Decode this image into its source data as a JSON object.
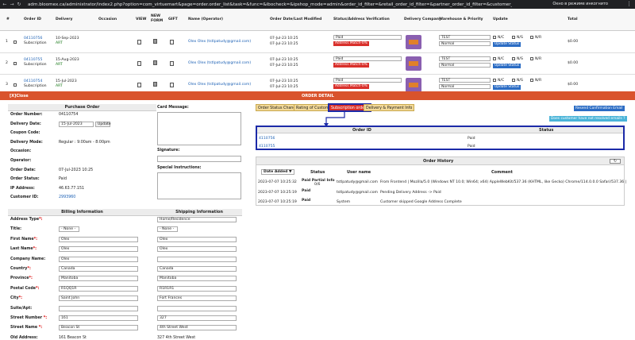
{
  "browser": {
    "url": "adm.bloomex.ca/administrator/index2.php?option=com_virtuemart&page=order.order_list&task=&func=&ibocheck=&ipshop_mode=admin&order_id_filter=&retail_order_id_filter=&partner_order_id_filter=&customer_name_filter=&user_email_filt...",
    "incognito": "Окно в режиме инкогнито"
  },
  "orders": {
    "headers": [
      "#",
      "Order ID",
      "Delivery",
      "Occasion",
      "VIEW",
      "NEW FORM",
      "GIFT",
      "Name (Operator)",
      "Order Date/Last Modified",
      "Status/Address Verification",
      "Delivery Company",
      "Warehouse & Priority",
      "Update",
      "Total"
    ],
    "rows": [
      {
        "n": "1",
        "id": "04110756",
        "type": "Subscription",
        "date": "10-Sep-2023",
        "wh": "ART",
        "name": "Olex Olex (tstlpatudy@gmail.com)",
        "od1": "07-Jul-23 10:25",
        "od2": "07-Jul-23 10:25",
        "status": "Paid",
        "addr": "Address Match-0%",
        "whs": "TEST",
        "prio": "Normal",
        "total": "$0.00"
      },
      {
        "n": "2",
        "id": "04110755",
        "type": "Subscription",
        "date": "15-Aug-2023",
        "wh": "ART",
        "name": "Olex Olex (tstlpatudy@gmail.com)",
        "od1": "07-Jul-23 10:25",
        "od2": "07-Jul-23 10:25",
        "status": "Paid",
        "addr": "Address Match-0%",
        "whs": "TEST",
        "prio": "Normal",
        "total": "$0.00"
      },
      {
        "n": "3",
        "id": "04110754",
        "type": "Subscription",
        "date": "15-Jul-2023",
        "wh": "ART",
        "name": "Olex Olex (tstlpatudy@gmail.com)",
        "od1": "07-Jul-23 10:25",
        "od2": "07-Jul-23 10:25",
        "status": "Paid",
        "addr": "Address Match-0%",
        "whs": "TEST",
        "prio": "Normal",
        "total": "$0.00"
      }
    ],
    "n_c": "N/C",
    "n_s": "N/S",
    "n_r": "N/R",
    "update": "Update Status"
  },
  "detail": {
    "close": "[X]Close",
    "title": "ORDER DETAIL"
  },
  "purchase": {
    "title": "Purchase Order",
    "fields": [
      {
        "l": "Order Number:",
        "v": "04110754"
      },
      {
        "l": "Delivery Date:",
        "v": "15-Jul-2023"
      },
      {
        "l": "Coupon Code:",
        "v": ""
      },
      {
        "l": "Delivery Mode:",
        "v": "Regular : 9:00am - 8:00pm"
      },
      {
        "l": "Occasion:",
        "v": ""
      },
      {
        "l": "Operator:",
        "v": ""
      },
      {
        "l": "Order Date:",
        "v": "07-Jul-2023 10:25"
      },
      {
        "l": "Order Status:",
        "v": "Paid"
      },
      {
        "l": "IP Address:",
        "v": "46.63.77.151"
      },
      {
        "l": "Customer ID:",
        "v": "2993960"
      }
    ],
    "update": "Update"
  },
  "notes": {
    "card": "Card Message:",
    "signature": "Signature:",
    "special": "Special Instructions:"
  },
  "billing": {
    "title": "Billing Information",
    "shipping_title": "Shipping Information",
    "rows": [
      {
        "l": "Address Type*:",
        "b": "",
        "s": "Home/Residence",
        "sel": true
      },
      {
        "l": "Title:",
        "b": "- None -",
        "s": "- None -",
        "sel": true
      },
      {
        "l": "First Name*:",
        "b": "Olex",
        "s": "Olex"
      },
      {
        "l": "Last Name*:",
        "b": "Olex",
        "s": "Olex"
      },
      {
        "l": "Company Name:",
        "b": "Olex",
        "s": ""
      },
      {
        "l": "Country*:",
        "b": "Canada",
        "s": "Canada",
        "sel": true
      },
      {
        "l": "Province*:",
        "b": "Manitoba",
        "s": "Manitoba",
        "sel": true
      },
      {
        "l": "Postal Code*:",
        "b": "R1QQ1R",
        "s": "R1R1R1"
      },
      {
        "l": "City*:",
        "b": "Saint John",
        "s": "Fort Frances"
      },
      {
        "l": "Suite/Apt:",
        "b": "",
        "s": ""
      },
      {
        "l": "Street Number *:",
        "b": "161",
        "s": "327"
      },
      {
        "l": "Street Name *:",
        "b": "Beacon St",
        "s": "4th Street West"
      },
      {
        "l": "Old Address:",
        "b": "161 Beacon St",
        "s": "327 4th Street West"
      }
    ]
  },
  "tabs": [
    "Order Status Change",
    "Rating of Customer",
    "Subscription orders",
    "Delivery & Payment Info"
  ],
  "actions": {
    "resend": "Resend Confirmation Email",
    "unresolved": "Does customer have not resolved emails ?"
  },
  "subs": {
    "headers": [
      "Order ID",
      "Status"
    ],
    "rows": [
      {
        "id": "4110756",
        "status": "Paid"
      },
      {
        "id": "4110755",
        "status": "Paid"
      }
    ]
  },
  "history": {
    "title": "Order History",
    "headers": [
      "Date Added ▼",
      "Status",
      "User name",
      "Comment"
    ],
    "rows": [
      {
        "d": "2023-07-07 10:25:32",
        "s": "Paid Partial Info",
        "s2": "0/6",
        "u": "tstlpatudy@gmail.com",
        "c": "From Frontend | Mozilla/5.0 (Windows NT 10.0; Win64; x64) AppleWebKit/537.36 (KHTML, like Gecko) Chrome/114.0.0.0 Safari/537.36 |"
      },
      {
        "d": "2023-07-07 10:25:19",
        "s": "Paid",
        "s2": "",
        "u": "tstlpatudy@gmail.com",
        "c": "Pending Delivery Address -> Paid"
      },
      {
        "d": "2023-07-07 10:25:19",
        "s": "Paid",
        "s2": "",
        "u": "System",
        "c": "Customer skipped Google Address Complete"
      }
    ]
  },
  "colors": {
    "accent": "#d9532c",
    "highlight": "#1c2aa8"
  }
}
